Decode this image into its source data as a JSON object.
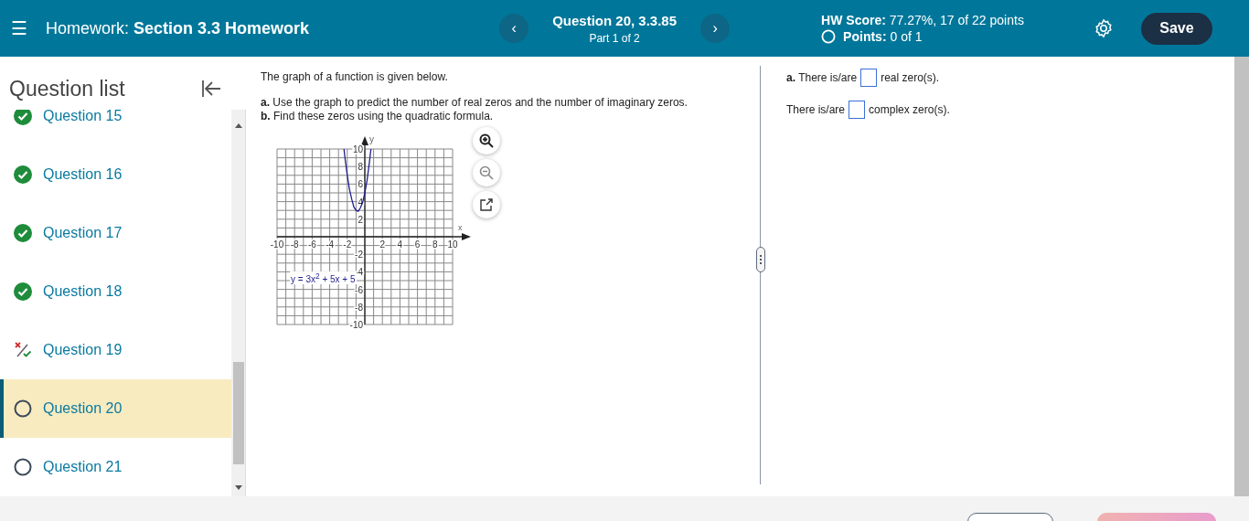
{
  "header": {
    "menu": "☰",
    "title_label": "Homework:",
    "title": "Section 3.3 Homework",
    "prev": "‹",
    "question": "Question 20, 3.3.85",
    "part": "Part 1 of 2",
    "next": "›",
    "score_label": "HW Score:",
    "score": "77.27%, 17 of 22 points",
    "points_label": "Points:",
    "points": "0 of 1",
    "save": "Save"
  },
  "sidebar": {
    "heading": "Question list",
    "questions": [
      {
        "label": "Question 15",
        "kind": "correct",
        "selected": false
      },
      {
        "label": "Question 16",
        "kind": "correct",
        "selected": false
      },
      {
        "label": "Question 17",
        "kind": "correct",
        "selected": false
      },
      {
        "label": "Question 18",
        "kind": "correct",
        "selected": false
      },
      {
        "label": "Question 19",
        "kind": "partial",
        "selected": false
      },
      {
        "label": "Question 20",
        "kind": "unanswered",
        "selected": true
      },
      {
        "label": "Question 21",
        "kind": "unanswered",
        "selected": false
      }
    ]
  },
  "question": {
    "intro": "The graph of a function is given below.",
    "parts": [
      "**a.** Use the graph to predict the number of real zeros and the number of imaginary zeros.",
      "**b.** Find these zeros using the quadratic formula."
    ],
    "chart_data": {
      "type": "line",
      "grid": true,
      "xlabel": "x",
      "ylabel": "y",
      "xlim": [
        -10,
        10
      ],
      "ylim": [
        -10,
        10
      ],
      "xticks": [
        -10,
        -8,
        -6,
        -4,
        -2,
        2,
        4,
        6,
        8,
        10
      ],
      "yticks": [
        -10,
        -8,
        -6,
        -4,
        -2,
        2,
        4,
        6,
        8,
        10
      ],
      "x": [
        -2.37,
        -2.25,
        -2,
        -1.75,
        -1.5,
        -1.25,
        -1,
        -0.75,
        -0.5,
        -0.25,
        0,
        0.25,
        0.5,
        0.7
      ],
      "series": [
        {
          "name": "y = 3x$^{2}$ + 5x + 5",
          "color": "#1f1f8f",
          "values": [
            10,
            8.9,
            7,
            5.4,
            4.3,
            3.4,
            3,
            2.9,
            3.3,
            3.9,
            5,
            6.4,
            8.3,
            10
          ]
        }
      ]
    }
  },
  "answers": [
    {
      "prefix": "**a.** There is/are",
      "suffix": "real zero(s)."
    },
    {
      "prefix": "There is/are",
      "suffix": "complex zero(s)."
    }
  ],
  "footer": {
    "buttons": [
      {
        "kind": "outline"
      },
      {
        "kind": "primary"
      }
    ]
  }
}
